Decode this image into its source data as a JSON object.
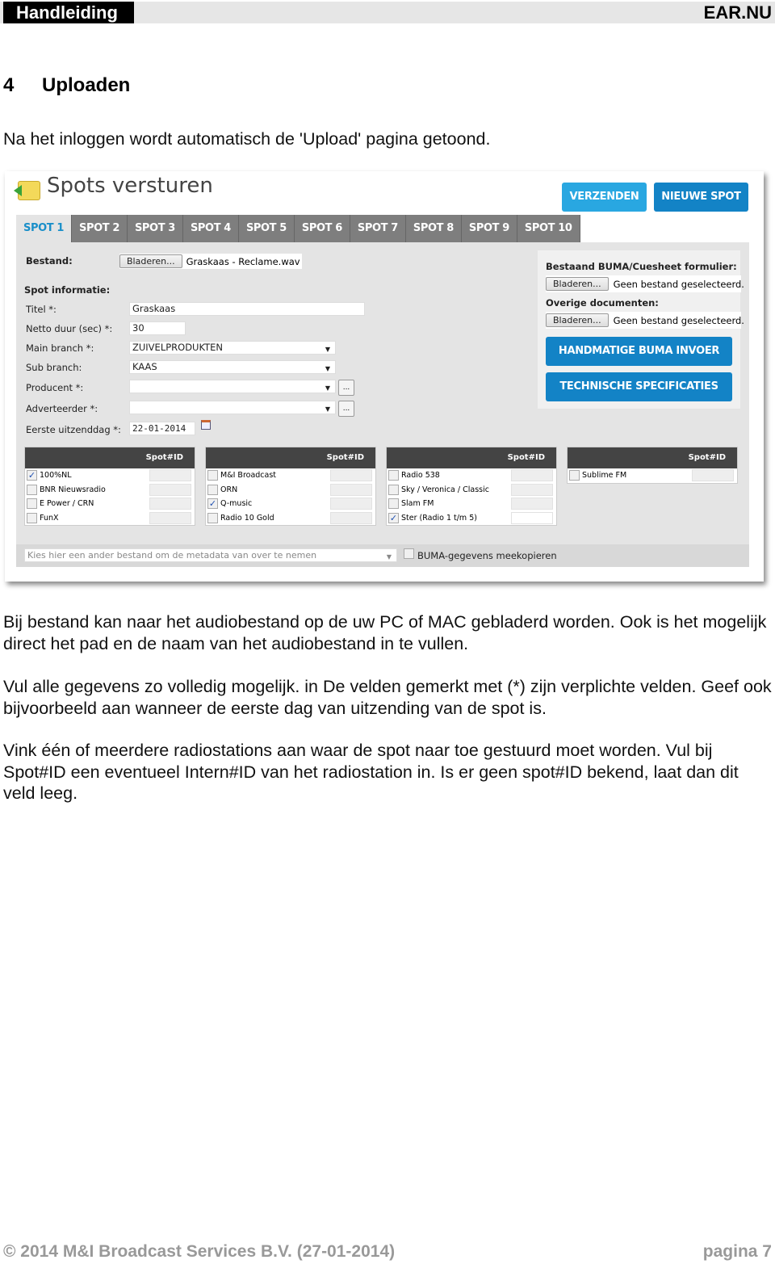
{
  "header": {
    "left": "Handleiding",
    "right": "EAR.NU"
  },
  "section": {
    "number": "4",
    "title": "Uploaden"
  },
  "intro": "Na het inloggen wordt automatisch de 'Upload' pagina getoond.",
  "app": {
    "title": "Spots versturen",
    "send_button": "VERZENDEN",
    "new_spot_button": "NIEUWE SPOT",
    "colors": {
      "accent": "#1a8fc9",
      "send": "#29a7e1",
      "tab_bar": "#7e7e7e"
    },
    "tabs": [
      "SPOT 1",
      "SPOT 2",
      "SPOT 3",
      "SPOT 4",
      "SPOT 5",
      "SPOT 6",
      "SPOT 7",
      "SPOT 8",
      "SPOT 9",
      "SPOT 10"
    ],
    "active_tab": "SPOT 1",
    "bestand": {
      "label": "Bestand:",
      "browse": "Bladeren...",
      "value": "Graskaas - Reclame.wav"
    },
    "spot_info": "Spot informatie:",
    "fields": {
      "titel": {
        "label": "Titel *:",
        "value": "Graskaas"
      },
      "duur": {
        "label": "Netto duur (sec) *:",
        "value": "30"
      },
      "main_branch": {
        "label": "Main branch *:",
        "value": "ZUIVELPRODUKTEN"
      },
      "sub_branch": {
        "label": "Sub branch:",
        "value": "KAAS"
      },
      "producent": {
        "label": "Producent *:",
        "value": "",
        "more": "..."
      },
      "adverteerder": {
        "label": "Adverteerder *:",
        "value": "",
        "more": "..."
      },
      "uitzenddag": {
        "label": "Eerste uitzenddag *:",
        "value": "22-01-2014"
      }
    },
    "side": {
      "buma_label": "Bestaand BUMA/Cuesheet formulier:",
      "buma_browse": "Bladeren...",
      "buma_value": "Geen bestand geselecteerd.",
      "docs_label": "Overige documenten:",
      "docs_browse": "Bladeren...",
      "docs_value": "Geen bestand geselecteerd.",
      "manual_button": "HANDMATIGE BUMA INVOER",
      "specs_button": "TECHNISCHE SPECIFICATIES"
    },
    "station_header": "Spot#ID",
    "stations": [
      [
        {
          "name": "100%NL",
          "checked": true
        },
        {
          "name": "BNR Nieuwsradio",
          "checked": false
        },
        {
          "name": "E Power / CRN",
          "checked": false
        },
        {
          "name": "FunX",
          "checked": false
        }
      ],
      [
        {
          "name": "M&I Broadcast",
          "checked": false
        },
        {
          "name": "ORN",
          "checked": false
        },
        {
          "name": "Q-music",
          "checked": true
        },
        {
          "name": "Radio 10 Gold",
          "checked": false
        }
      ],
      [
        {
          "name": "Radio 538",
          "checked": false
        },
        {
          "name": "Sky / Veronica / Classic",
          "checked": false
        },
        {
          "name": "Slam FM",
          "checked": false
        },
        {
          "name": "Ster (Radio 1 t/m 5)",
          "checked": true
        }
      ],
      [
        {
          "name": "Sublime FM",
          "checked": false
        }
      ]
    ],
    "metadata_select": "Kies hier een ander bestand om de metadata van over te nemen",
    "buma_copy": "BUMA-gegevens meekopieren"
  },
  "paragraphs": [
    "Bij bestand kan naar het audiobestand op de uw PC of MAC gebladerd worden. Ook is het mogelijk direct het pad en de naam van het audiobestand in te vullen.",
    "Vul alle gegevens zo volledig mogelijk. in De velden gemerkt met (*) zijn verplichte velden. Geef ook bijvoorbeeld aan wanneer de eerste dag van uitzending van de spot is.",
    "Vink één of meerdere radiostations aan waar de spot naar toe gestuurd moet worden. Vul bij Spot#ID een eventueel Intern#ID van het radiostation in. Is er geen spot#ID bekend, laat dan dit veld leeg."
  ],
  "footer": {
    "left": "© 2014 M&I Broadcast Services B.V. (27-01-2014)",
    "right": "pagina 7"
  }
}
